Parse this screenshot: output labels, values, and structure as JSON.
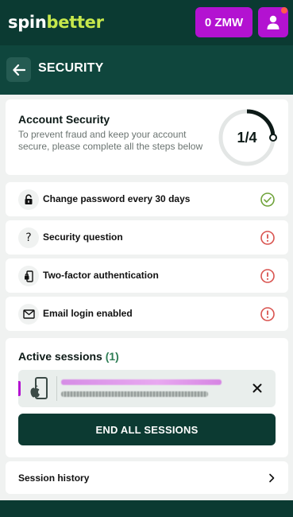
{
  "brand": {
    "spin": "spin",
    "better": "better",
    "colors": {
      "primary": "#0b3a32",
      "accent": "#b312d1",
      "logo_green": "#c6e84c"
    }
  },
  "topbar": {
    "balance": "0 ZMW",
    "profile_icon": "user-icon",
    "notification_indicator": true
  },
  "header": {
    "title": "SECURITY",
    "back_icon": "arrow-left-icon"
  },
  "security_summary": {
    "title": "Account Security",
    "description": "To prevent fraud and keep your account secure, please complete all the steps below",
    "progress_label": "1/4",
    "completed": 1,
    "total": 4
  },
  "steps": [
    {
      "label": "Change password every 30 days",
      "icon": "lock-icon",
      "status": "completed"
    },
    {
      "label": "Security question",
      "icon": "question-icon",
      "status": "warning"
    },
    {
      "label": "Two-factor authentication",
      "icon": "phone-lock-icon",
      "status": "warning"
    },
    {
      "label": "Email login enabled",
      "icon": "envelope-icon",
      "status": "warning"
    }
  ],
  "sessions": {
    "title": "Active sessions",
    "count": "(1)",
    "items": [
      {
        "device_icon": "apple-phone-icon"
      }
    ],
    "end_all_label": "END ALL SESSIONS"
  },
  "session_history": {
    "label": "Session history"
  },
  "status_colors": {
    "completed": "#6fa33a",
    "warning": "#d9534f"
  }
}
